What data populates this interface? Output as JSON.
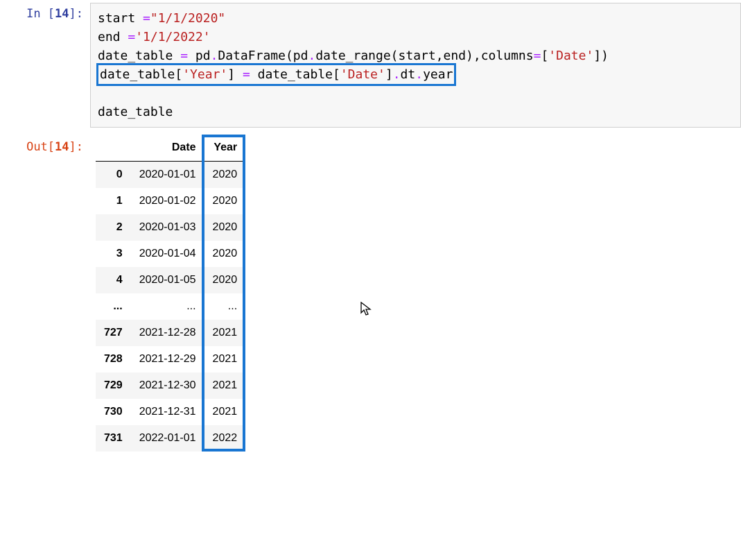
{
  "input": {
    "prompt_label": "In [",
    "prompt_num": "14",
    "prompt_close": "]:",
    "tokens": {
      "l1_a": "start ",
      "l1_op": "=",
      "l1_b": "\"1/1/2020\"",
      "l2_a": "end ",
      "l2_op": "=",
      "l2_b": "'1/1/2022'",
      "l3_a": "date_table ",
      "l3_op": "=",
      "l3_b": " pd",
      "l3_dot1": ".",
      "l3_c": "DataFrame(pd",
      "l3_dot2": ".",
      "l3_d": "date_range(start,end),columns",
      "l3_op2": "=",
      "l3_e": "[",
      "l3_str": "'Date'",
      "l3_f": "])",
      "l4_a": "date_table[",
      "l4_s1": "'Year'",
      "l4_b": "] ",
      "l4_op": "=",
      "l4_c": " date_table[",
      "l4_s2": "'Date'",
      "l4_d": "]",
      "l4_dot": ".",
      "l4_e": "dt",
      "l4_dot2": ".",
      "l4_f": "year",
      "l6": "date_table"
    }
  },
  "output": {
    "prompt_label": "Out[",
    "prompt_num": "14",
    "prompt_close": "]:",
    "columns": {
      "index": "",
      "date": "Date",
      "year": "Year"
    },
    "rows": [
      {
        "idx": "0",
        "date": "2020-01-01",
        "year": "2020"
      },
      {
        "idx": "1",
        "date": "2020-01-02",
        "year": "2020"
      },
      {
        "idx": "2",
        "date": "2020-01-03",
        "year": "2020"
      },
      {
        "idx": "3",
        "date": "2020-01-04",
        "year": "2020"
      },
      {
        "idx": "4",
        "date": "2020-01-05",
        "year": "2020"
      },
      {
        "idx": "...",
        "date": "...",
        "year": "..."
      },
      {
        "idx": "727",
        "date": "2021-12-28",
        "year": "2021"
      },
      {
        "idx": "728",
        "date": "2021-12-29",
        "year": "2021"
      },
      {
        "idx": "729",
        "date": "2021-12-30",
        "year": "2021"
      },
      {
        "idx": "730",
        "date": "2021-12-31",
        "year": "2021"
      },
      {
        "idx": "731",
        "date": "2022-01-01",
        "year": "2022"
      }
    ]
  }
}
